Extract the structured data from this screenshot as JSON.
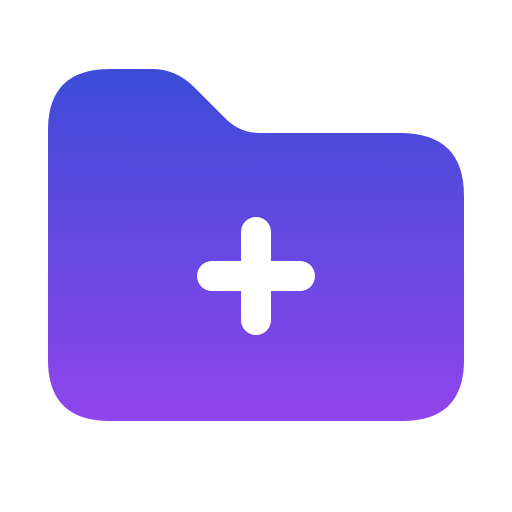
{
  "icon": {
    "name": "folder-add-icon",
    "gradient_top": "#3C4BD8",
    "gradient_bottom": "#9045EC",
    "plus_color": "#FFFFFF"
  }
}
